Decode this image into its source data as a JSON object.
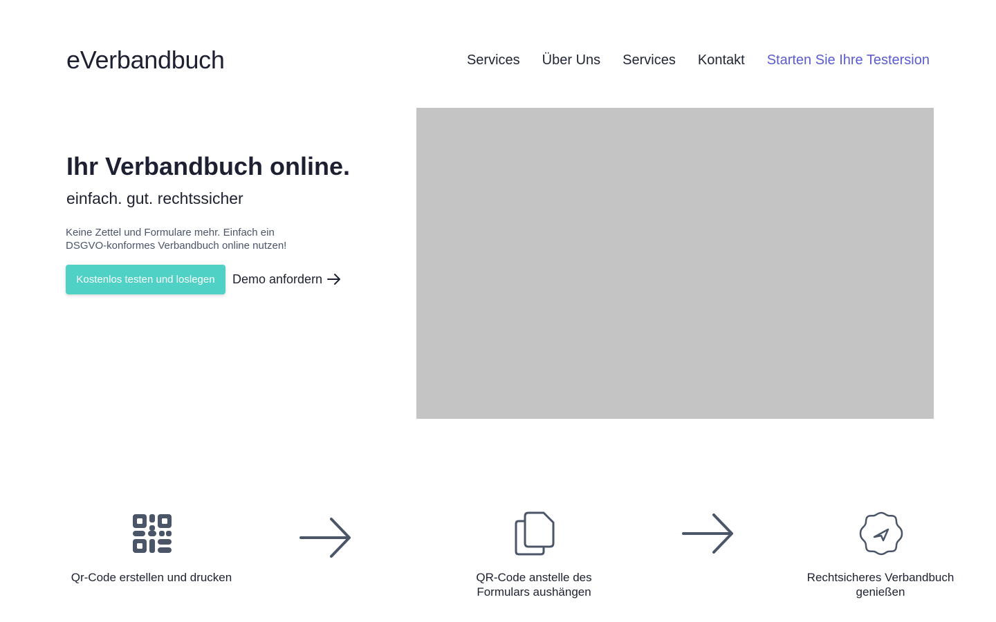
{
  "header": {
    "logo": "eVerbandbuch",
    "nav": [
      {
        "label": "Services"
      },
      {
        "label": "Über Uns"
      },
      {
        "label": "Services"
      },
      {
        "label": "Kontakt"
      },
      {
        "label": "Starten Sie Ihre Testersion"
      }
    ]
  },
  "hero": {
    "title": "Ihr Verbandbuch online.",
    "subtitle": "einfach. gut. rechtssicher",
    "description_lines": [
      "Keine Zettel und Formulare mehr. Einfach ein",
      "DSGVO-konformes Verbandbuch online nutzen!"
    ],
    "primary_button": "Kostenlos testen und loslegen",
    "secondary_button": "Demo anfordern",
    "image_color": "#c4c4c4"
  },
  "steps": [
    {
      "icon": "qr-code-icon",
      "label_lines": [
        "Qr-Code erstellen und drucken"
      ]
    },
    {
      "icon": "copy-documents-icon",
      "label_lines": [
        "QR-Code anstelle des",
        "Formulars aushängen"
      ]
    },
    {
      "icon": "verified-badge-icon",
      "label_lines": [
        "Rechtsicheres Verbandbuch",
        "genießen"
      ]
    }
  ],
  "colors": {
    "accent_teal": "#4fd1c5",
    "link_purple": "#5b5bd0",
    "icon_slate": "#4a5568",
    "text_dark": "#1c2030"
  }
}
